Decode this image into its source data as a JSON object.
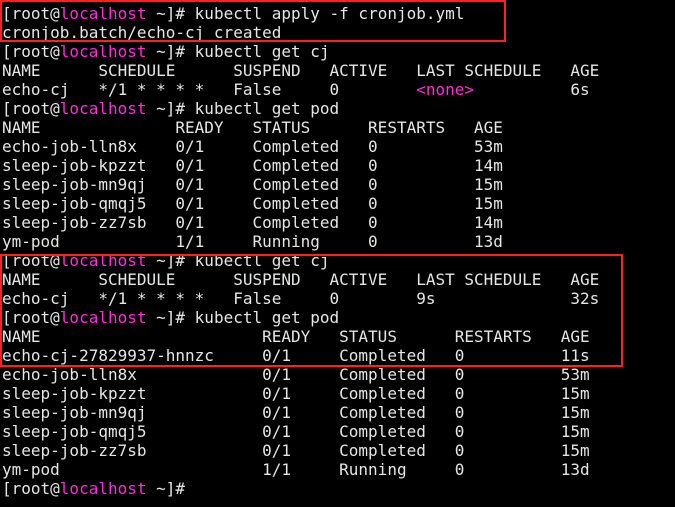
{
  "terminal": {
    "prompt": {
      "open": "[root@",
      "host": "localhost",
      "rest": " ~]# "
    },
    "lines": [
      {
        "type": "prompt",
        "cmd": "kubectl apply -f cronjob.yml"
      },
      {
        "type": "text",
        "text": "cronjob.batch/echo-cj created"
      },
      {
        "type": "prompt",
        "cmd": "kubectl get cj"
      },
      {
        "type": "text",
        "text": "NAME      SCHEDULE      SUSPEND   ACTIVE   LAST SCHEDULE   AGE"
      },
      {
        "type": "cj-none",
        "before": "echo-cj   */1 * * * *   False     0        ",
        "none": "<none>",
        "after": "          6s"
      },
      {
        "type": "prompt",
        "cmd": "kubectl get pod"
      },
      {
        "type": "text",
        "text": "NAME              READY   STATUS      RESTARTS   AGE"
      },
      {
        "type": "text",
        "text": "echo-job-lln8x    0/1     Completed   0          53m"
      },
      {
        "type": "text",
        "text": "sleep-job-kpzzt   0/1     Completed   0          14m"
      },
      {
        "type": "text",
        "text": "sleep-job-mn9qj   0/1     Completed   0          15m"
      },
      {
        "type": "text",
        "text": "sleep-job-qmqj5   0/1     Completed   0          15m"
      },
      {
        "type": "text",
        "text": "sleep-job-zz7sb   0/1     Completed   0          14m"
      },
      {
        "type": "text",
        "text": "ym-pod            1/1     Running     0          13d"
      },
      {
        "type": "prompt",
        "cmd": "kubectl get cj"
      },
      {
        "type": "text",
        "text": "NAME      SCHEDULE      SUSPEND   ACTIVE   LAST SCHEDULE   AGE"
      },
      {
        "type": "text",
        "text": "echo-cj   */1 * * * *   False     0        9s              32s"
      },
      {
        "type": "prompt",
        "cmd": "kubectl get pod"
      },
      {
        "type": "text",
        "text": "NAME                       READY   STATUS      RESTARTS   AGE"
      },
      {
        "type": "text",
        "text": "echo-cj-27829937-hnnzc     0/1     Completed   0          11s"
      },
      {
        "type": "text",
        "text": "echo-job-lln8x             0/1     Completed   0          53m"
      },
      {
        "type": "text",
        "text": "sleep-job-kpzzt            0/1     Completed   0          15m"
      },
      {
        "type": "text",
        "text": "sleep-job-mn9qj            0/1     Completed   0          15m"
      },
      {
        "type": "text",
        "text": "sleep-job-qmqj5            0/1     Completed   0          15m"
      },
      {
        "type": "text",
        "text": "sleep-job-zz7sb            0/1     Completed   0          15m"
      },
      {
        "type": "text",
        "text": "ym-pod                     1/1     Running     0          13d"
      },
      {
        "type": "prompt",
        "cmd": ""
      }
    ]
  },
  "colors": {
    "background": "#000000",
    "text": "#e6e6e6",
    "hostname": "#ff2fd6",
    "highlight_border": "#ff2020"
  }
}
